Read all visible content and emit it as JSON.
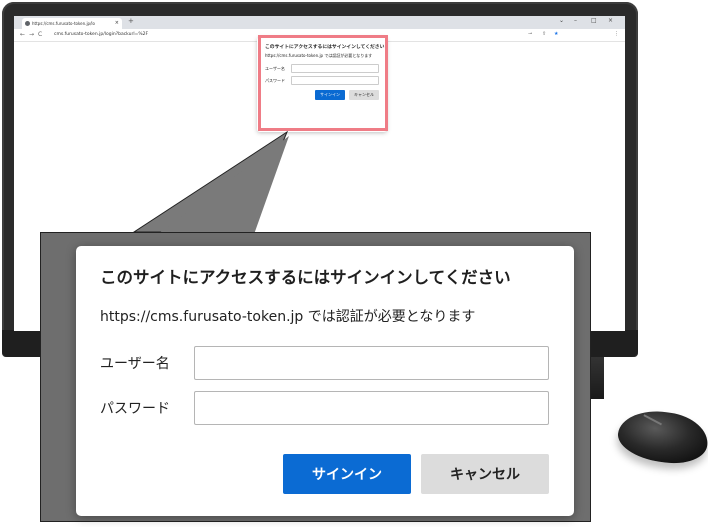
{
  "browser": {
    "tab_title": "https://cms.furusato-token.jp/lo",
    "tab_close": "×",
    "new_tab": "+",
    "url": "cms.furusato-token.jp/login?backurl=%2F",
    "nav_back": "←",
    "nav_forward": "→",
    "nav_reload": "C",
    "win_minimize": "–",
    "win_maximize": "□",
    "win_close": "×",
    "chevron": "⌄",
    "menu": "⋮"
  },
  "dialog": {
    "title": "このサイトにアクセスするにはサインインしてください",
    "message": "https://cms.furusato-token.jp では認証が必要となります",
    "username_label": "ユーザー名",
    "username_value": "",
    "password_label": "パスワード",
    "password_value": "",
    "signin_label": "サインイン",
    "cancel_label": "キャンセル"
  },
  "colors": {
    "highlight": "#ef7c86",
    "primary_button": "#0b6bd3",
    "secondary_button": "#dcdcdc"
  }
}
